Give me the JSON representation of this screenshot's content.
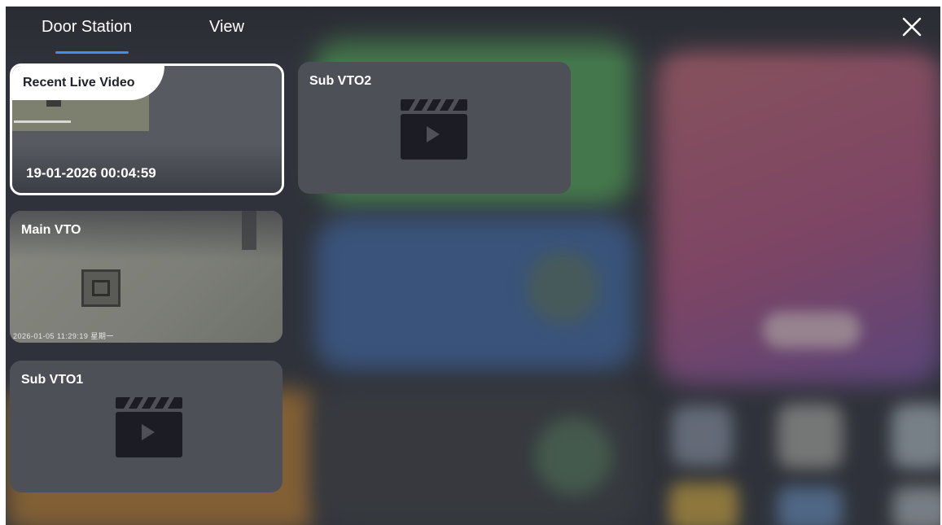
{
  "tabs": {
    "door_station": "Door Station",
    "view": "View"
  },
  "accent_color": "#3b8ff0",
  "cards": {
    "recent": {
      "label": "Recent Live Video",
      "timestamp": "19-01-2026 00:04:59"
    },
    "sub_vto2": {
      "label": "Sub VTO2",
      "icon": "video-clapperboard-icon"
    },
    "main_vto": {
      "label": "Main VTO",
      "osd": "2026-01-05 11:29:19 星期一"
    },
    "sub_vto1": {
      "label": "Sub VTO1",
      "icon": "video-clapperboard-icon"
    }
  },
  "close_icon": "close-icon"
}
